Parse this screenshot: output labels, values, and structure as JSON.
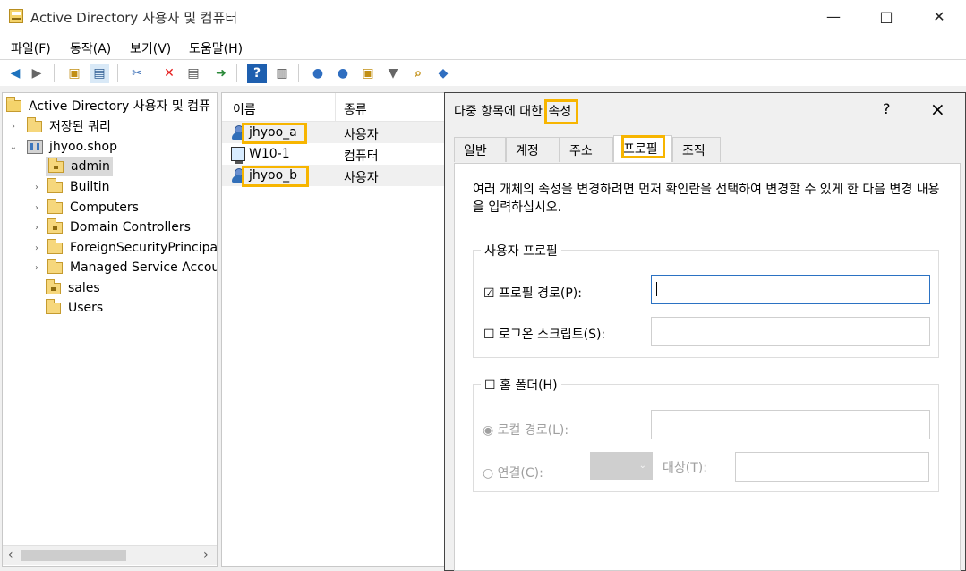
{
  "window": {
    "title": "Active Directory 사용자 및 컴퓨터",
    "minimize_icon": "minimize-icon",
    "maximize_icon": "maximize-icon",
    "close_icon": "close-icon"
  },
  "menu": [
    "파일(F)",
    "동작(A)",
    "보기(V)",
    "도움말(H)"
  ],
  "toolbar": {
    "icons": [
      "back-icon",
      "forward-icon",
      "up-folder-icon",
      "show-console-tree-icon",
      "cut-icon",
      "delete-icon",
      "properties-icon",
      "export-icon",
      "help-icon",
      "show-action-pane-icon",
      "new-user-icon",
      "new-group-icon",
      "new-ou-icon",
      "filter-icon",
      "find-icon",
      "add-to-group-icon"
    ],
    "accent_blue": "#1e73be",
    "delete_red": "#e51d1d"
  },
  "tree": {
    "root": "Active Directory 사용자 및 컴퓨",
    "saved_queries": "저장된 쿼리",
    "domain": "jhyoo.shop",
    "items": [
      "admin",
      "Builtin",
      "Computers",
      "Domain Controllers",
      "ForeignSecurityPrincipals",
      "Managed Service Accour",
      "sales",
      "Users"
    ],
    "scroll_left": "‹",
    "scroll_right": "›"
  },
  "list": {
    "columns": [
      "이름",
      "종류"
    ],
    "rows": [
      {
        "name": "jhyoo_a",
        "type": "사용자",
        "icon": "user-icon"
      },
      {
        "name": "W10-1",
        "type": "컴퓨터",
        "icon": "computer-icon"
      },
      {
        "name": "jhyoo_b",
        "type": "사용자",
        "icon": "user-icon"
      }
    ],
    "highlight_color": "#f7b500"
  },
  "dialog": {
    "title_prefix": "다중 항목에 대한 ",
    "title_highlight": "속성",
    "help": "?",
    "close": "×",
    "tabs": [
      "일반",
      "계정",
      "주소",
      "프로필",
      "조직"
    ],
    "active_tab": "프로필",
    "description": "여러 개체의 속성을 변경하려면 먼저 확인란을 선택하여 변경할 수 있게 한 다음 변경 내용을 입력하십시오.",
    "user_profile_group": "사용자 프로필",
    "profile_path_label": "☑ 프로필 경로(P):",
    "logon_script_label": "☐ 로그온 스크립트(S):",
    "home_folder_group": "☐ 홈 폴더(H)",
    "local_path_label": "◉ 로컬 경로(L):",
    "connect_label": "○ 연결(C):",
    "target_label": "대상(T):",
    "profile_path_value": "",
    "logon_script_value": "",
    "local_path_value": "",
    "target_value": "",
    "drive_value": "",
    "dropdown_arrow": "⌄"
  }
}
